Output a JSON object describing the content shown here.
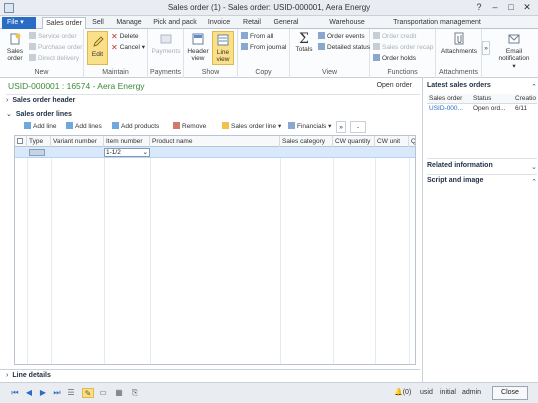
{
  "window": {
    "title": "Sales order (1) - Sales order: USID-000001, Aera Energy",
    "controls": [
      "?",
      "–",
      "□",
      "✕"
    ]
  },
  "tabs": {
    "file": "File",
    "items": [
      "Sales order",
      "Sell",
      "Manage",
      "Pick and pack",
      "Invoice",
      "Retail",
      "General",
      "Warehouse management",
      "Transportation management"
    ]
  },
  "ribbon": {
    "new": {
      "label": "New",
      "sales_order": "Sales order",
      "service_order": "Service order",
      "purchase_order": "Purchase order",
      "direct_delivery": "Direct delivery"
    },
    "maintain": {
      "label": "Maintain",
      "edit": "Edit",
      "delete": "Delete",
      "cancel": "Cancel"
    },
    "payments": {
      "label": "Payments",
      "payments": "Payments"
    },
    "show": {
      "label": "Show",
      "header_view": "Header view",
      "line_view": "Line view"
    },
    "copy": {
      "label": "Copy",
      "from_all": "From all",
      "from_journal": "From journal"
    },
    "view": {
      "label": "View",
      "totals": "Totals",
      "order_events": "Order events",
      "detailed_status": "Detailed status"
    },
    "functions": {
      "label": "Functions",
      "order_credit": "Order credit",
      "sales_order_recap": "Sales order recap",
      "order_holds": "Order holds"
    },
    "attachments": {
      "label": "Attachments",
      "attachments": "Attachments"
    },
    "more": "»",
    "email_notification": "Email notification"
  },
  "form": {
    "record": "USID-000001 : 16574 - Aera Energy",
    "open_order": "Open order",
    "sales_order_header": "Sales order header",
    "sales_order_lines": "Sales order lines",
    "line_details": "Line details"
  },
  "grid_toolbar": {
    "add_line": "Add line",
    "add_lines": "Add lines",
    "add_products": "Add products",
    "remove": "Remove",
    "sales_order_line": "Sales order line",
    "financials": "Financials",
    "more": "»",
    "dash": "-"
  },
  "grid": {
    "columns": [
      "Type",
      "Variant number",
      "Item number",
      "Product name",
      "Sales category",
      "CW quantity",
      "CW unit",
      "Q"
    ],
    "row": {
      "item_number": "1-1/2"
    }
  },
  "right_pane": {
    "latest_sales_orders": "Latest sales orders",
    "columns": [
      "Sales order",
      "Status",
      "Creatio"
    ],
    "row": [
      "USID-000...",
      "Open ord...",
      "6/11"
    ],
    "related_information": "Related information",
    "script_and_image": "Script and image"
  },
  "status_bar": {
    "notifications": "(0)",
    "user": "usid",
    "company": "initial",
    "role": "admin",
    "close": "Close"
  },
  "colors": {
    "accent": "#2a6cc4",
    "record_green": "#3a8a3a",
    "selected_row": "#d7e9fb",
    "highlight": "#fbe08a"
  }
}
